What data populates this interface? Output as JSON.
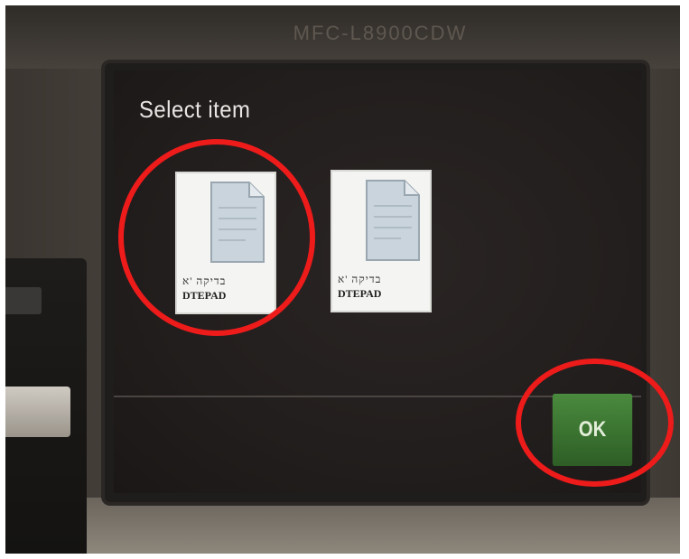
{
  "device": {
    "model_label": "MFC-L8900CDW"
  },
  "screen": {
    "title": "Select item",
    "files": [
      {
        "sub": "בדיקה 'א",
        "name": "DTEPAD",
        "selected": true
      },
      {
        "sub": "בדיקה 'א",
        "name": "DTEPAD",
        "selected": false
      }
    ],
    "ok_label": "OK"
  },
  "annotations": {
    "circle_color": "#ee1b1b"
  },
  "icons": {
    "file": "document-icon"
  }
}
